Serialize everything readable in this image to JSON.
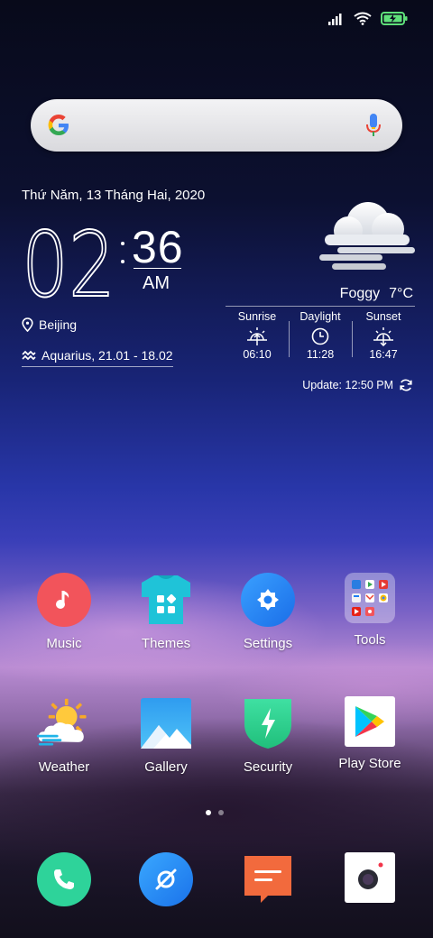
{
  "status_bar": {
    "signal_icon": "signal-bars-icon",
    "wifi_icon": "wifi-icon",
    "battery_icon": "battery-charging-icon",
    "battery_color": "#5fe07a"
  },
  "search": {
    "logo_icon": "google-logo-icon",
    "mic_icon": "microphone-icon"
  },
  "clock": {
    "date": "Thứ Năm, 13 Tháng Hai, 2020",
    "hours": "02",
    "minutes": "36",
    "ampm": "AM",
    "location": "Beijing",
    "zodiac": "Aquarius, 21.01 - 18.02"
  },
  "weather": {
    "condition": "Foggy",
    "temperature": "7°C",
    "sunrise_label": "Sunrise",
    "sunrise_time": "06:10",
    "daylight_label": "Daylight",
    "daylight_time": "11:28",
    "sunset_label": "Sunset",
    "sunset_time": "16:47",
    "update": "Update: 12:50 PM"
  },
  "apps": {
    "music": "Music",
    "themes": "Themes",
    "settings": "Settings",
    "tools": "Tools",
    "weather": "Weather",
    "gallery": "Gallery",
    "security": "Security",
    "play_store": "Play Store"
  },
  "dock": {
    "phone_icon": "phone-icon",
    "browser_icon": "browser-icon",
    "messages_icon": "messages-icon",
    "camera_icon": "camera-icon"
  },
  "page_indicator": {
    "pages": 2,
    "current": 1
  },
  "colors": {
    "music": "#f2545b",
    "themes": "#1fc3d8",
    "settings": "#1f7ef2",
    "security": "#2fcf8c",
    "phone": "#2ed39a",
    "browser": "#1f8cf2",
    "messages": "#f26a3d"
  }
}
